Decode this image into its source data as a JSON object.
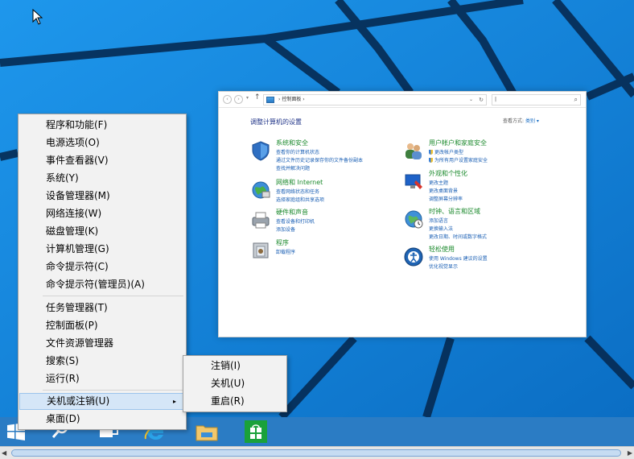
{
  "control_panel": {
    "breadcrumb": "控制面板",
    "breadcrumb_sep": "›",
    "search_placeholder": "",
    "heading": "调整计算机的设置",
    "view_by_label": "查看方式:",
    "view_by_value": "类别 ▾",
    "categories": [
      {
        "title": "系统和安全",
        "links": [
          "查看你的计算机状态",
          "通过文件历史记录保存你的文件备份副本",
          "查找并解决问题"
        ],
        "icon": "shield-icon"
      },
      {
        "title": "网络和 Internet",
        "links": [
          "查看网络状态和任务",
          "选择家庭组和共享选项"
        ],
        "icon": "network-icon"
      },
      {
        "title": "硬件和声音",
        "links": [
          "查看设备和打印机",
          "添加设备"
        ],
        "icon": "printer-icon"
      },
      {
        "title": "程序",
        "links": [
          "卸载程序"
        ],
        "icon": "programs-icon"
      },
      {
        "title": "用户帐户和家庭安全",
        "links": [
          "更改帐户类型",
          "为所有用户设置家庭安全"
        ],
        "icon": "users-icon"
      },
      {
        "title": "外观和个性化",
        "links": [
          "更改主题",
          "更改桌面背景",
          "调整屏幕分辨率"
        ],
        "icon": "appearance-icon"
      },
      {
        "title": "时钟、语言和区域",
        "links": [
          "添加语言",
          "更换输入法",
          "更改日期、时间或数字格式"
        ],
        "icon": "clock-globe-icon"
      },
      {
        "title": "轻松使用",
        "links": [
          "使用 Windows 建议的设置",
          "优化视觉显示"
        ],
        "icon": "ease-of-access-icon"
      }
    ]
  },
  "context_menu": {
    "group1": [
      "程序和功能(F)",
      "电源选项(O)",
      "事件查看器(V)",
      "系统(Y)",
      "设备管理器(M)",
      "网络连接(W)",
      "磁盘管理(K)",
      "计算机管理(G)",
      "命令提示符(C)",
      "命令提示符(管理员)(A)"
    ],
    "group2": [
      "任务管理器(T)",
      "控制面板(P)",
      "文件资源管理器",
      "搜索(S)",
      "运行(R)"
    ],
    "group3": [
      "关机或注销(U)",
      "桌面(D)"
    ],
    "submenu_arrow": "▸"
  },
  "submenu": {
    "items": [
      "注销(I)",
      "关机(U)",
      "重启(R)"
    ]
  },
  "taskbar": {
    "icons": [
      "windows-start-icon",
      "search-icon",
      "task-view-icon",
      "internet-explorer-icon",
      "file-explorer-icon",
      "store-icon"
    ]
  },
  "scrollbar": {
    "left": "◀",
    "right": "▶"
  }
}
